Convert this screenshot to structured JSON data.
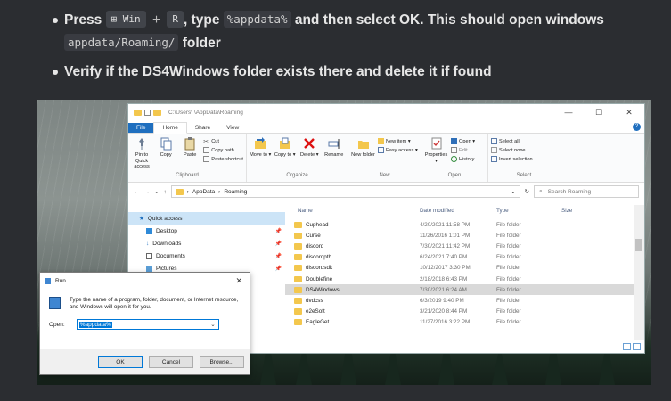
{
  "instructions": [
    {
      "press_label": "Press",
      "key1": "⊞ Win",
      "plus": "+",
      "key2": "R",
      "type_label": ", type",
      "code1": "%appdata%",
      "rest": "and then select OK. This should open windows",
      "code2": "appdata/Roaming/",
      "tail": "folder"
    },
    {
      "text": "Verify if the DS4Windows folder exists there and delete it if found"
    }
  ],
  "explorer": {
    "path_text": "C:\\Users\\     \\AppData\\Roaming",
    "window_buttons": [
      "—",
      "☐",
      "✕"
    ],
    "tabs": [
      "File",
      "Home",
      "Share",
      "View"
    ],
    "help_glyph": "?",
    "ribbon": {
      "clipboard": {
        "pin_label": "Pin to Quick access",
        "copy_label": "Copy",
        "paste_label": "Paste",
        "cut_label": "Cut",
        "copy_path_label": "Copy path",
        "paste_shortcut_label": "Paste shortcut",
        "title": "Clipboard"
      },
      "organize": {
        "move_label": "Move to ▾",
        "copy_to_label": "Copy to ▾",
        "delete_label": "Delete ▾",
        "rename_label": "Rename",
        "title": "Organize"
      },
      "new": {
        "new_folder_label": "New folder",
        "new_item_label": "New item ▾",
        "easy_access_label": "Easy access ▾",
        "title": "New"
      },
      "open": {
        "properties_label": "Properties ▾",
        "open_label": "Open ▾",
        "edit_label": "Edit",
        "history_label": "History",
        "title": "Open"
      },
      "select": {
        "select_all_label": "Select all",
        "select_none_label": "Select none",
        "invert_label": "Invert selection",
        "title": "Select"
      }
    },
    "address": {
      "crumbs": [
        "›",
        "AppData",
        "›",
        "Roaming"
      ],
      "search_placeholder": "Search Roaming"
    },
    "nav": [
      {
        "label": "Quick access",
        "pin": ""
      },
      {
        "label": "Desktop",
        "pin": "📌"
      },
      {
        "label": "Downloads",
        "pin": "📌"
      },
      {
        "label": "Documents",
        "pin": "📌"
      },
      {
        "label": "Pictures",
        "pin": "📌"
      }
    ],
    "columns": [
      "Name",
      "Date modified",
      "Type",
      "Size"
    ],
    "files": [
      {
        "name": "Cuphead",
        "date": "4/20/2021 11:58 PM",
        "type": "File folder"
      },
      {
        "name": "Curse",
        "date": "11/26/2016 1:01 PM",
        "type": "File folder"
      },
      {
        "name": "discord",
        "date": "7/30/2021 11:42 PM",
        "type": "File folder"
      },
      {
        "name": "discordptb",
        "date": "6/24/2021 7:40 PM",
        "type": "File folder"
      },
      {
        "name": "discordsdk",
        "date": "10/12/2017 3:30 PM",
        "type": "File folder"
      },
      {
        "name": "Doublefine",
        "date": "2/18/2018 6:43 PM",
        "type": "File folder"
      },
      {
        "name": "DS4Windows",
        "date": "7/30/2021 6:24 AM",
        "type": "File folder",
        "selected": true
      },
      {
        "name": "dvdcss",
        "date": "6/3/2019 9:40 PM",
        "type": "File folder"
      },
      {
        "name": "e2eSoft",
        "date": "3/21/2020 8:44 PM",
        "type": "File folder"
      },
      {
        "name": "EagleGet",
        "date": "11/27/2016 3:22 PM",
        "type": "File folder"
      }
    ]
  },
  "run_dialog": {
    "title": "Run",
    "close_glyph": "✕",
    "description": "Type the name of a program, folder, document, or Internet resource, and Windows will open it for you.",
    "open_label": "Open:",
    "open_value": "%appdata%",
    "dropdown_glyph": "⌄",
    "ok_label": "OK",
    "cancel_label": "Cancel",
    "browse_label": "Browse..."
  }
}
